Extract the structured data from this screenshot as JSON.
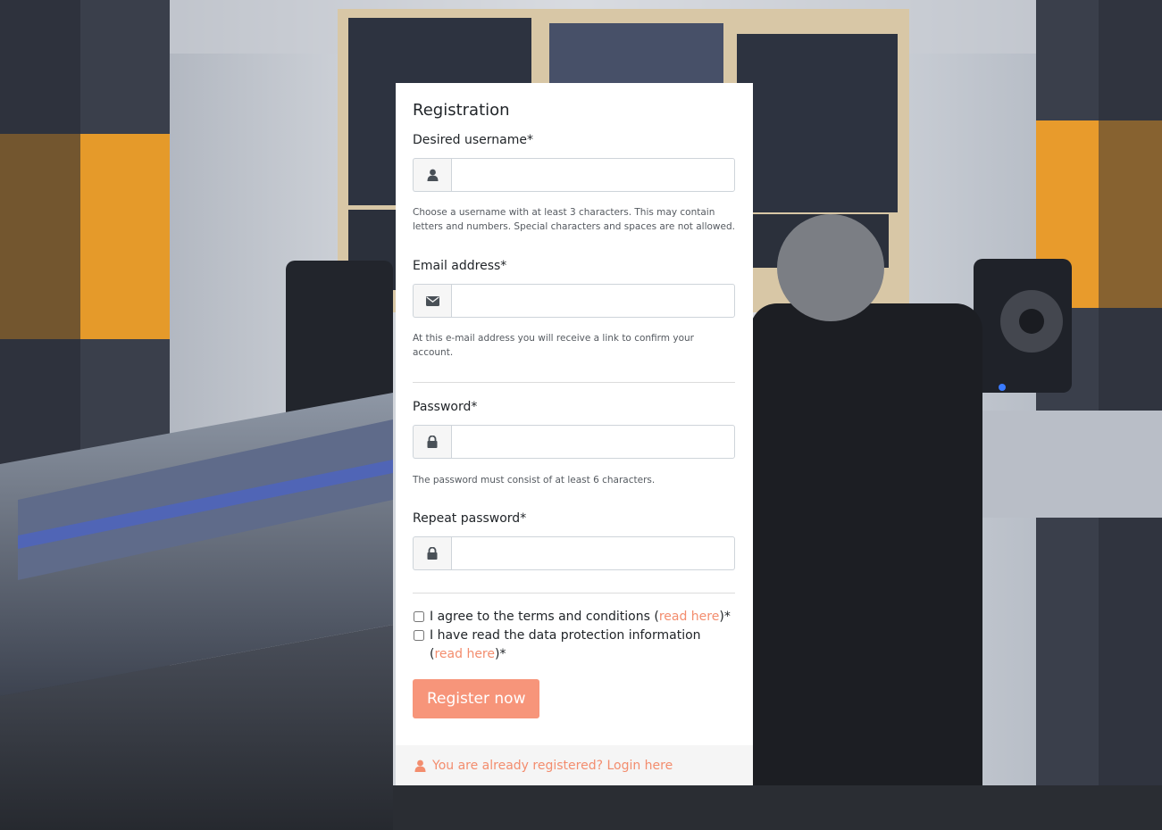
{
  "form": {
    "title": "Registration",
    "username": {
      "label": "Desired username*",
      "value": "",
      "help": "Choose a username with at least 3 characters. This may contain letters and numbers. Special characters and spaces are not allowed.",
      "icon": "user-icon"
    },
    "email": {
      "label": "Email address*",
      "value": "",
      "help": "At this e-mail address you will receive a link to confirm your account.",
      "icon": "envelope-icon"
    },
    "password": {
      "label": "Password*",
      "value": "",
      "help": "The password must consist of at least 6 characters.",
      "icon": "lock-icon"
    },
    "repeat_password": {
      "label": "Repeat password*",
      "value": "",
      "icon": "lock-icon"
    },
    "terms": {
      "text_before": "I agree to the terms and conditions (",
      "link": "read here",
      "text_after": ")*",
      "checked": false
    },
    "privacy": {
      "text_before": "I have read the data protection information (",
      "link": "read here",
      "text_after": ")*",
      "checked": false
    },
    "submit_label": "Register now"
  },
  "footer": {
    "login_text": "You are already registered? Login here",
    "icon": "user-icon"
  },
  "colors": {
    "accent": "#f7957a",
    "link": "#f38d6e",
    "card_bg": "#ffffff",
    "footer_bg": "#f5f5f5"
  }
}
